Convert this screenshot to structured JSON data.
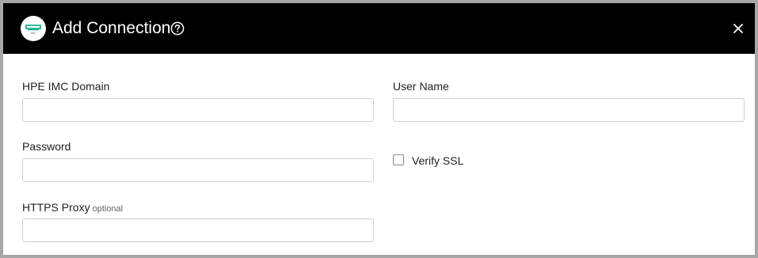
{
  "dialog": {
    "title": "Add Connection",
    "logo_icon": "hpe-imc-logo-icon",
    "help_icon": "help-circle-icon",
    "close_icon": "close-icon",
    "colors": {
      "header_bg": "#000000",
      "header_text": "#ffffff",
      "logo_accent": "#01a982"
    }
  },
  "form": {
    "domain": {
      "label": "HPE IMC Domain",
      "value": "",
      "placeholder": ""
    },
    "username": {
      "label": "User Name",
      "value": "",
      "placeholder": ""
    },
    "password": {
      "label": "Password",
      "value": "",
      "placeholder": ""
    },
    "verify_ssl": {
      "label": "Verify SSL",
      "checked": false
    },
    "proxy": {
      "label": "HTTPS Proxy",
      "optional_text": "optional",
      "value": "",
      "placeholder": ""
    }
  }
}
